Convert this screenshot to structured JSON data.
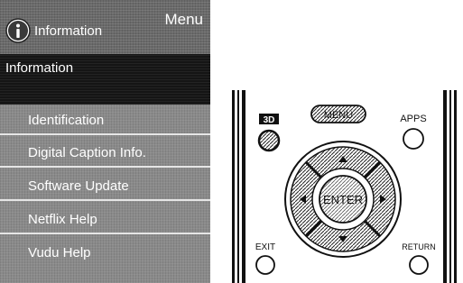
{
  "menu": {
    "header_title": "Information",
    "corner_label": "Menu",
    "selected_item": "Information",
    "items": [
      {
        "label": "Identification"
      },
      {
        "label": "Digital Caption Info."
      },
      {
        "label": "Software Update"
      },
      {
        "label": "Netflix Help"
      },
      {
        "label": "Vudu Help"
      }
    ]
  },
  "remote": {
    "btn_3d": "3D",
    "btn_menu": "MENU",
    "btn_apps": "APPS",
    "btn_enter": "ENTER",
    "btn_exit": "EXIT",
    "btn_return": "RETURN"
  },
  "icons": {
    "info": "info-icon",
    "arrows": [
      "arrow-up-icon",
      "arrow-down-icon",
      "arrow-left-icon",
      "arrow-right-icon"
    ]
  },
  "colors": {
    "panel_gray": "#8a8a8a",
    "header_gray": "#6a6a6a",
    "selected_black": "#151515",
    "text": "#ffffff"
  }
}
